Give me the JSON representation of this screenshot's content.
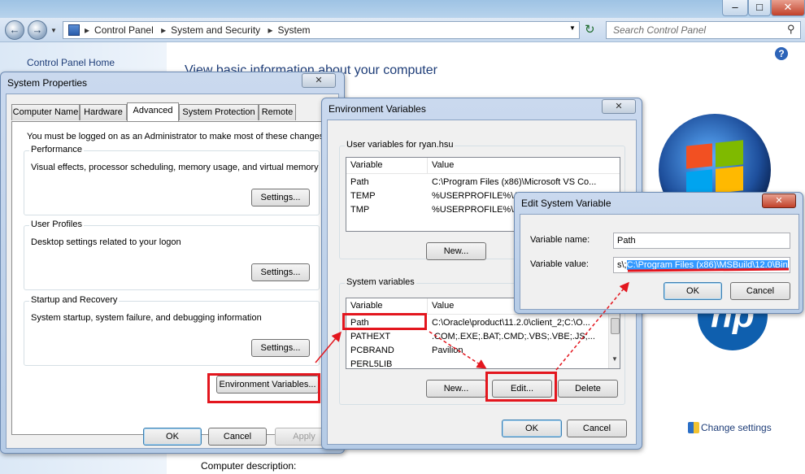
{
  "explorer": {
    "breadcrumb": [
      "Control Panel",
      "System and Security",
      "System"
    ],
    "search_placeholder": "Search Control Panel",
    "left_link": "Control Panel Home",
    "heading": "View basic information about your computer",
    "change_settings": "Change settings",
    "computer_description": "Computer description:",
    "oem_logo": "hp"
  },
  "system_properties": {
    "title": "System Properties",
    "tabs": [
      "Computer Name",
      "Hardware",
      "Advanced",
      "System Protection",
      "Remote"
    ],
    "active_tab": "Advanced",
    "notice": "You must be logged on as an Administrator to make most of these changes.",
    "performance": {
      "title": "Performance",
      "desc": "Visual effects, processor scheduling, memory usage, and virtual memory",
      "button": "Settings..."
    },
    "user_profiles": {
      "title": "User Profiles",
      "desc": "Desktop settings related to your logon",
      "button": "Settings..."
    },
    "startup": {
      "title": "Startup and Recovery",
      "desc": "System startup, system failure, and debugging information",
      "button": "Settings..."
    },
    "env_button": "Environment Variables...",
    "ok": "OK",
    "cancel": "Cancel",
    "apply": "Apply"
  },
  "env_vars": {
    "title": "Environment Variables",
    "user_group": "User variables for ryan.hsu",
    "col_variable": "Variable",
    "col_value": "Value",
    "user_rows": [
      {
        "name": "Path",
        "value": "C:\\Program Files (x86)\\Microsoft VS Co..."
      },
      {
        "name": "TEMP",
        "value": "%USERPROFILE%\\Ap"
      },
      {
        "name": "TMP",
        "value": "%USERPROFILE%\\Ap"
      }
    ],
    "user_new": "New...",
    "system_group": "System variables",
    "system_rows": [
      {
        "name": "Path",
        "value": "C:\\Oracle\\product\\11.2.0\\client_2;C:\\O..."
      },
      {
        "name": "PATHEXT",
        "value": ".COM;.EXE;.BAT;.CMD;.VBS;.VBE;.JS;..."
      },
      {
        "name": "PCBRAND",
        "value": "Pavilion"
      },
      {
        "name": "PERL5LIB",
        "value": ""
      }
    ],
    "sys_new": "New...",
    "sys_edit": "Edit...",
    "sys_delete": "Delete",
    "ok": "OK",
    "cancel": "Cancel"
  },
  "edit_var": {
    "title": "Edit System Variable",
    "name_label": "Variable name:",
    "name_value": "Path",
    "value_label": "Variable value:",
    "value_prefix": "s\\;",
    "value_selected": "C:\\Program Files (x86)\\MSBuild\\12.0\\Bin",
    "ok": "OK",
    "cancel": "Cancel"
  },
  "colors": {
    "highlight": "#e3161e",
    "selection": "#3399ff",
    "link": "#1e3d78"
  }
}
